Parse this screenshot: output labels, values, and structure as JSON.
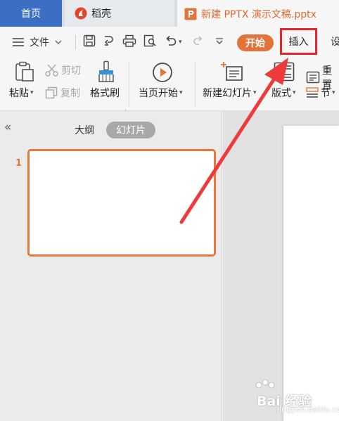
{
  "tabs": {
    "home": "首页",
    "daoke": "稻壳",
    "document": "新建 PPTX 演示文稿.pptx"
  },
  "menu": {
    "file": "文件",
    "start": "开始",
    "insert": "插入",
    "settings_partial": "设"
  },
  "ribbon": {
    "paste": "粘贴",
    "cut": "剪切",
    "copy": "复制",
    "format_painter": "格式刷",
    "play_from_current": "当页开始",
    "new_slide": "新建幻灯片",
    "layout": "版式",
    "reset": "重置",
    "section": "节"
  },
  "side_panel": {
    "outline_tab": "大纲",
    "slides_tab": "幻灯片",
    "slide_number": "1"
  },
  "watermark": {
    "text": "Bai 经验",
    "sub": "jingyan.baidu.com"
  },
  "colors": {
    "accent": "#e2743a",
    "highlight": "#e8242c",
    "home_tab": "#3c6fc4"
  }
}
